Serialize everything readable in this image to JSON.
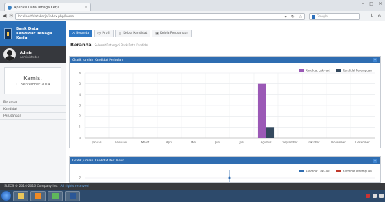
{
  "browser": {
    "tab_title": "Aplikasi Data Tenaga Kerja",
    "url": "localhost/datakerja/index.php/home",
    "search_placeholder": "Google"
  },
  "sidebar": {
    "brand": "Bank Data Kandidat Tenaga Kerja",
    "user": {
      "name": "Admin",
      "subtitle": "Administrator"
    },
    "date": {
      "day": "Kamis,",
      "full": "11 September 2014"
    },
    "menu": [
      {
        "label": "Beranda"
      },
      {
        "label": "Kandidat"
      },
      {
        "label": "Perusahaan"
      }
    ]
  },
  "tabs": [
    {
      "label": "Beranda",
      "icon": "home-icon",
      "active": true
    },
    {
      "label": "Profil",
      "icon": "user-icon",
      "active": false
    },
    {
      "label": "Kelola Kandidat",
      "icon": "folder-icon",
      "active": false
    },
    {
      "label": "Kelola Perusahaan",
      "icon": "building-icon",
      "active": false
    }
  ],
  "page": {
    "title": "Beranda",
    "subtitle": "Selamat Datang di Bank Data Kandidat"
  },
  "panel1": {
    "title": "Grafik Jumlah Kandidat Perbulan",
    "collapse": "−"
  },
  "panel2": {
    "title": "Grafik Jumlah Kandidat Per Tahun",
    "collapse": "−"
  },
  "statusbar": {
    "text": "SLECS © 2014-2016 Company Inc.",
    "link": "All rights reserved"
  },
  "colors": {
    "brand": "#2a6fb8",
    "series1": "#9b59b6",
    "series2": "#34495e",
    "series3": "#c0392b",
    "line": "#2f6db1"
  },
  "chart_data": [
    {
      "type": "bar",
      "title": "Grafik Jumlah Kandidat Perbulan",
      "categories": [
        "Januari",
        "Februari",
        "Maret",
        "April",
        "Mei",
        "Juni",
        "Juli",
        "Agustus",
        "September",
        "Oktober",
        "November",
        "Desember"
      ],
      "series": [
        {
          "name": "Kandidat Laki-laki",
          "values": [
            0,
            0,
            0,
            0,
            0,
            0,
            0,
            5,
            0,
            0,
            0,
            0
          ],
          "color": "#9b59b6"
        },
        {
          "name": "Kandidat Perempuan",
          "values": [
            0,
            0,
            0,
            0,
            0,
            0,
            0,
            1,
            0,
            0,
            0,
            0
          ],
          "color": "#34495e"
        }
      ],
      "ylim": [
        0,
        6
      ],
      "yticks": [
        0,
        1,
        2,
        3,
        4,
        5,
        6
      ],
      "grid": true,
      "legend": "top-right"
    },
    {
      "type": "line",
      "title": "Grafik Jumlah Kandidat Per Tahun",
      "series": [
        {
          "name": "Kandidat Laki-laki",
          "color": "#2f6db1"
        },
        {
          "name": "Kandidat Perempuan",
          "color": "#c0392b"
        }
      ],
      "yticks": [
        2
      ],
      "legend": "top-right"
    }
  ]
}
